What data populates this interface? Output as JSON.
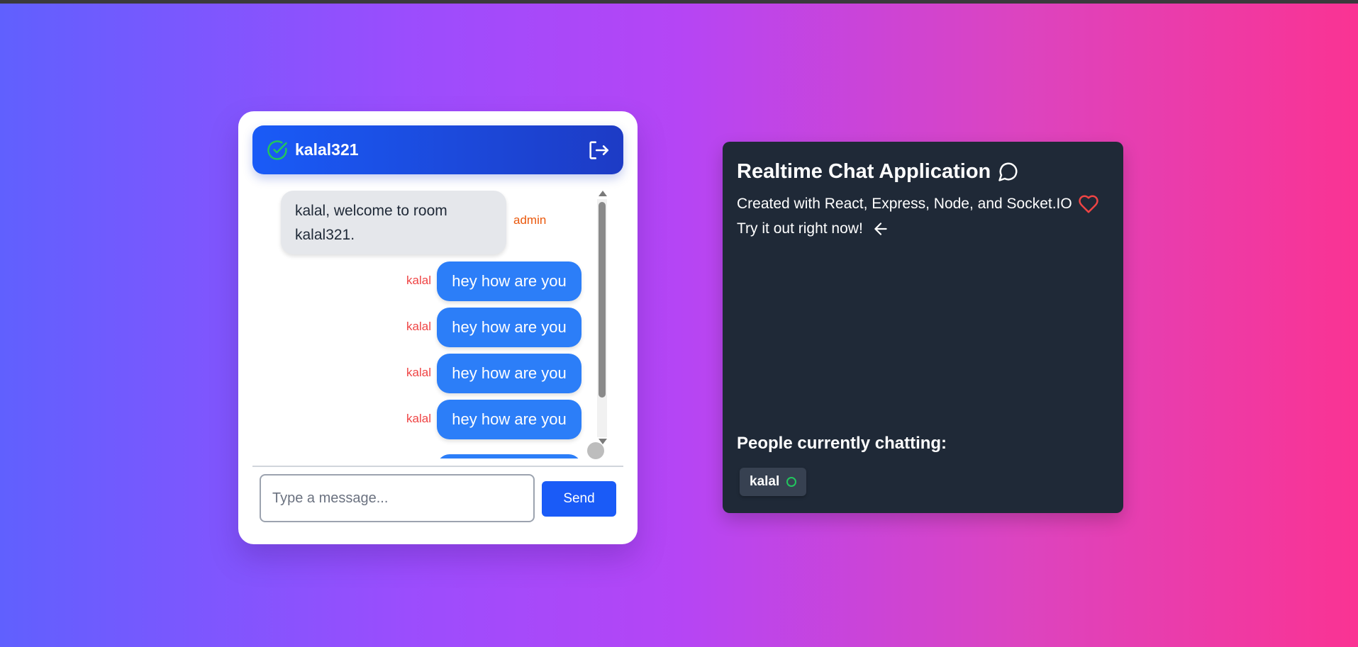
{
  "chat": {
    "room_name": "kalal321",
    "admin_message": {
      "text": "kalal, welcome to room kalal321.",
      "sender": "admin"
    },
    "messages": [
      {
        "sender": "kalal",
        "text": "hey how are you"
      },
      {
        "sender": "kalal",
        "text": "hey how are you"
      },
      {
        "sender": "kalal",
        "text": "hey how are you"
      },
      {
        "sender": "kalal",
        "text": "hey how are you"
      }
    ],
    "input_placeholder": "Type a message...",
    "input_value": "",
    "send_label": "Send"
  },
  "info": {
    "title": "Realtime Chat Application",
    "line1": "Created with React, Express, Node, and Socket.IO",
    "line2": "Try it out right now!",
    "people_heading": "People currently chatting:",
    "users": [
      {
        "name": "kalal"
      }
    ]
  },
  "colors": {
    "header_start": "#1a5bf7",
    "header_end": "#1d3bc5",
    "own_bubble": "#2c7ef8",
    "admin_sender": "#ea580c",
    "own_sender": "#ef4444",
    "online": "#22c55e",
    "panel_bg": "#1f2937",
    "heart": "#ef4444"
  },
  "icons": {
    "status": "check-circle-icon",
    "leave": "logout-icon",
    "chat": "chat-bubble-icon",
    "heart": "heart-icon",
    "arrow": "arrow-left-icon",
    "online": "online-dot-icon"
  }
}
